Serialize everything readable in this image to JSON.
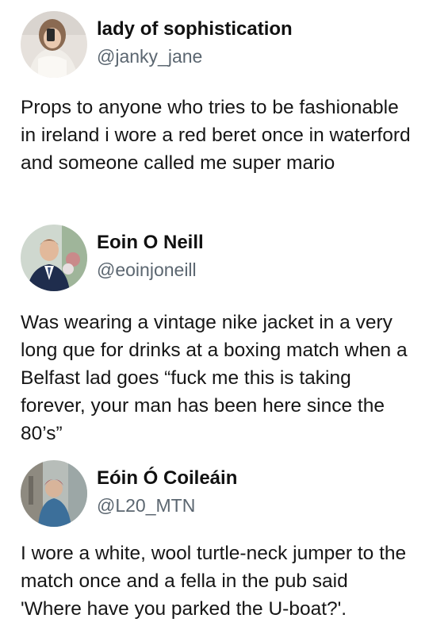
{
  "tweets": [
    {
      "display_name": "lady of sophistication",
      "handle": "@janky_jane",
      "text": "Props to anyone who tries to be fashionable in ireland i wore a red beret once in waterford and someone called me super mario"
    },
    {
      "display_name": "Eoin O Neill",
      "handle": "@eoinjoneill",
      "text": "Was wearing a vintage nike jacket in a very long que for drinks at a boxing match when a Belfast lad goes “fuck me this is taking forever, your man has been here since the 80’s”"
    },
    {
      "display_name": "Eóin Ó Coileáin",
      "handle": "@L20_MTN",
      "text": "I wore a white, wool turtle-neck jumper to the match once and a fella in the pub said 'Where have you parked the U-boat?'."
    }
  ]
}
